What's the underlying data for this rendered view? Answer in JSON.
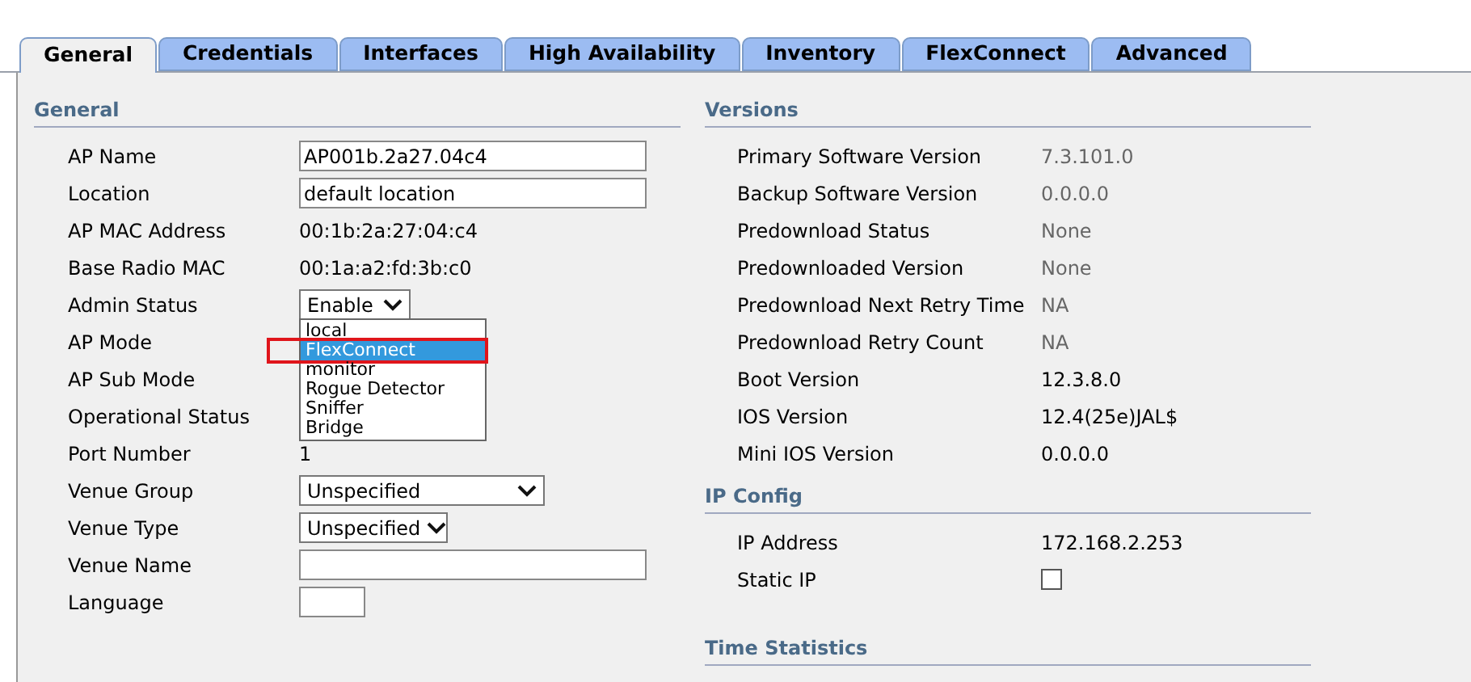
{
  "tabs": [
    {
      "label": "General",
      "selected": true
    },
    {
      "label": "Credentials",
      "selected": false
    },
    {
      "label": "Interfaces",
      "selected": false
    },
    {
      "label": "High Availability",
      "selected": false
    },
    {
      "label": "Inventory",
      "selected": false
    },
    {
      "label": "FlexConnect",
      "selected": false
    },
    {
      "label": "Advanced",
      "selected": false
    }
  ],
  "general": {
    "title": "General",
    "rows": [
      {
        "label": "AP Name",
        "kind": "input",
        "value": "AP001b.2a27.04c4"
      },
      {
        "label": "Location",
        "kind": "input",
        "value": "default location"
      },
      {
        "label": "AP MAC Address",
        "kind": "text",
        "value": "00:1b:2a:27:04:c4"
      },
      {
        "label": "Base Radio MAC",
        "kind": "text",
        "value": "00:1a:a2:fd:3b:c0"
      },
      {
        "label": "Admin Status",
        "kind": "select",
        "value": "Enable",
        "open": true,
        "options": [
          {
            "label": "local",
            "selected": false,
            "annotated": false
          },
          {
            "label": "FlexConnect",
            "selected": true,
            "annotated": true
          },
          {
            "label": "monitor",
            "selected": false,
            "annotated": false
          },
          {
            "label": "Rogue Detector",
            "selected": false,
            "annotated": false
          },
          {
            "label": "Sniffer",
            "selected": false,
            "annotated": false
          },
          {
            "label": "Bridge",
            "selected": false,
            "annotated": false
          }
        ]
      },
      {
        "label": "AP Mode",
        "kind": "label"
      },
      {
        "label": "AP Sub Mode",
        "kind": "label"
      },
      {
        "label": "Operational Status",
        "kind": "label"
      },
      {
        "label": "Port Number",
        "kind": "text",
        "value": "1"
      },
      {
        "label": "Venue Group",
        "kind": "select",
        "value": "Unspecified",
        "wide": true,
        "open": false
      },
      {
        "label": "Venue Type",
        "kind": "select",
        "value": "Unspecified",
        "wide": false,
        "open": false
      },
      {
        "label": "Venue Name",
        "kind": "input",
        "value": ""
      },
      {
        "label": "Language",
        "kind": "short_input",
        "value": ""
      }
    ]
  },
  "versions": {
    "title": "Versions",
    "rows": [
      {
        "label": "Primary Software Version",
        "value": "7.3.101.0",
        "disabled": true
      },
      {
        "label": "Backup Software Version",
        "value": "0.0.0.0",
        "disabled": true
      },
      {
        "label": "Predownload Status",
        "value": "None",
        "disabled": true
      },
      {
        "label": "Predownloaded Version",
        "value": "None",
        "disabled": true
      },
      {
        "label": "Predownload Next Retry Time",
        "value": "NA",
        "disabled": true
      },
      {
        "label": "Predownload Retry Count",
        "value": "NA",
        "disabled": true
      },
      {
        "label": "Boot Version",
        "value": "12.3.8.0",
        "disabled": false
      },
      {
        "label": "IOS Version",
        "value": "12.4(25e)JAL$",
        "disabled": false
      },
      {
        "label": "Mini IOS Version",
        "value": "0.0.0.0",
        "disabled": false
      }
    ]
  },
  "ip_config": {
    "title": "IP Config",
    "rows": [
      {
        "label": "IP Address",
        "kind": "text",
        "value": "172.168.2.253"
      },
      {
        "label": "Static IP",
        "kind": "checkbox",
        "checked": false
      }
    ]
  },
  "time_statistics": {
    "title": "Time Statistics"
  }
}
